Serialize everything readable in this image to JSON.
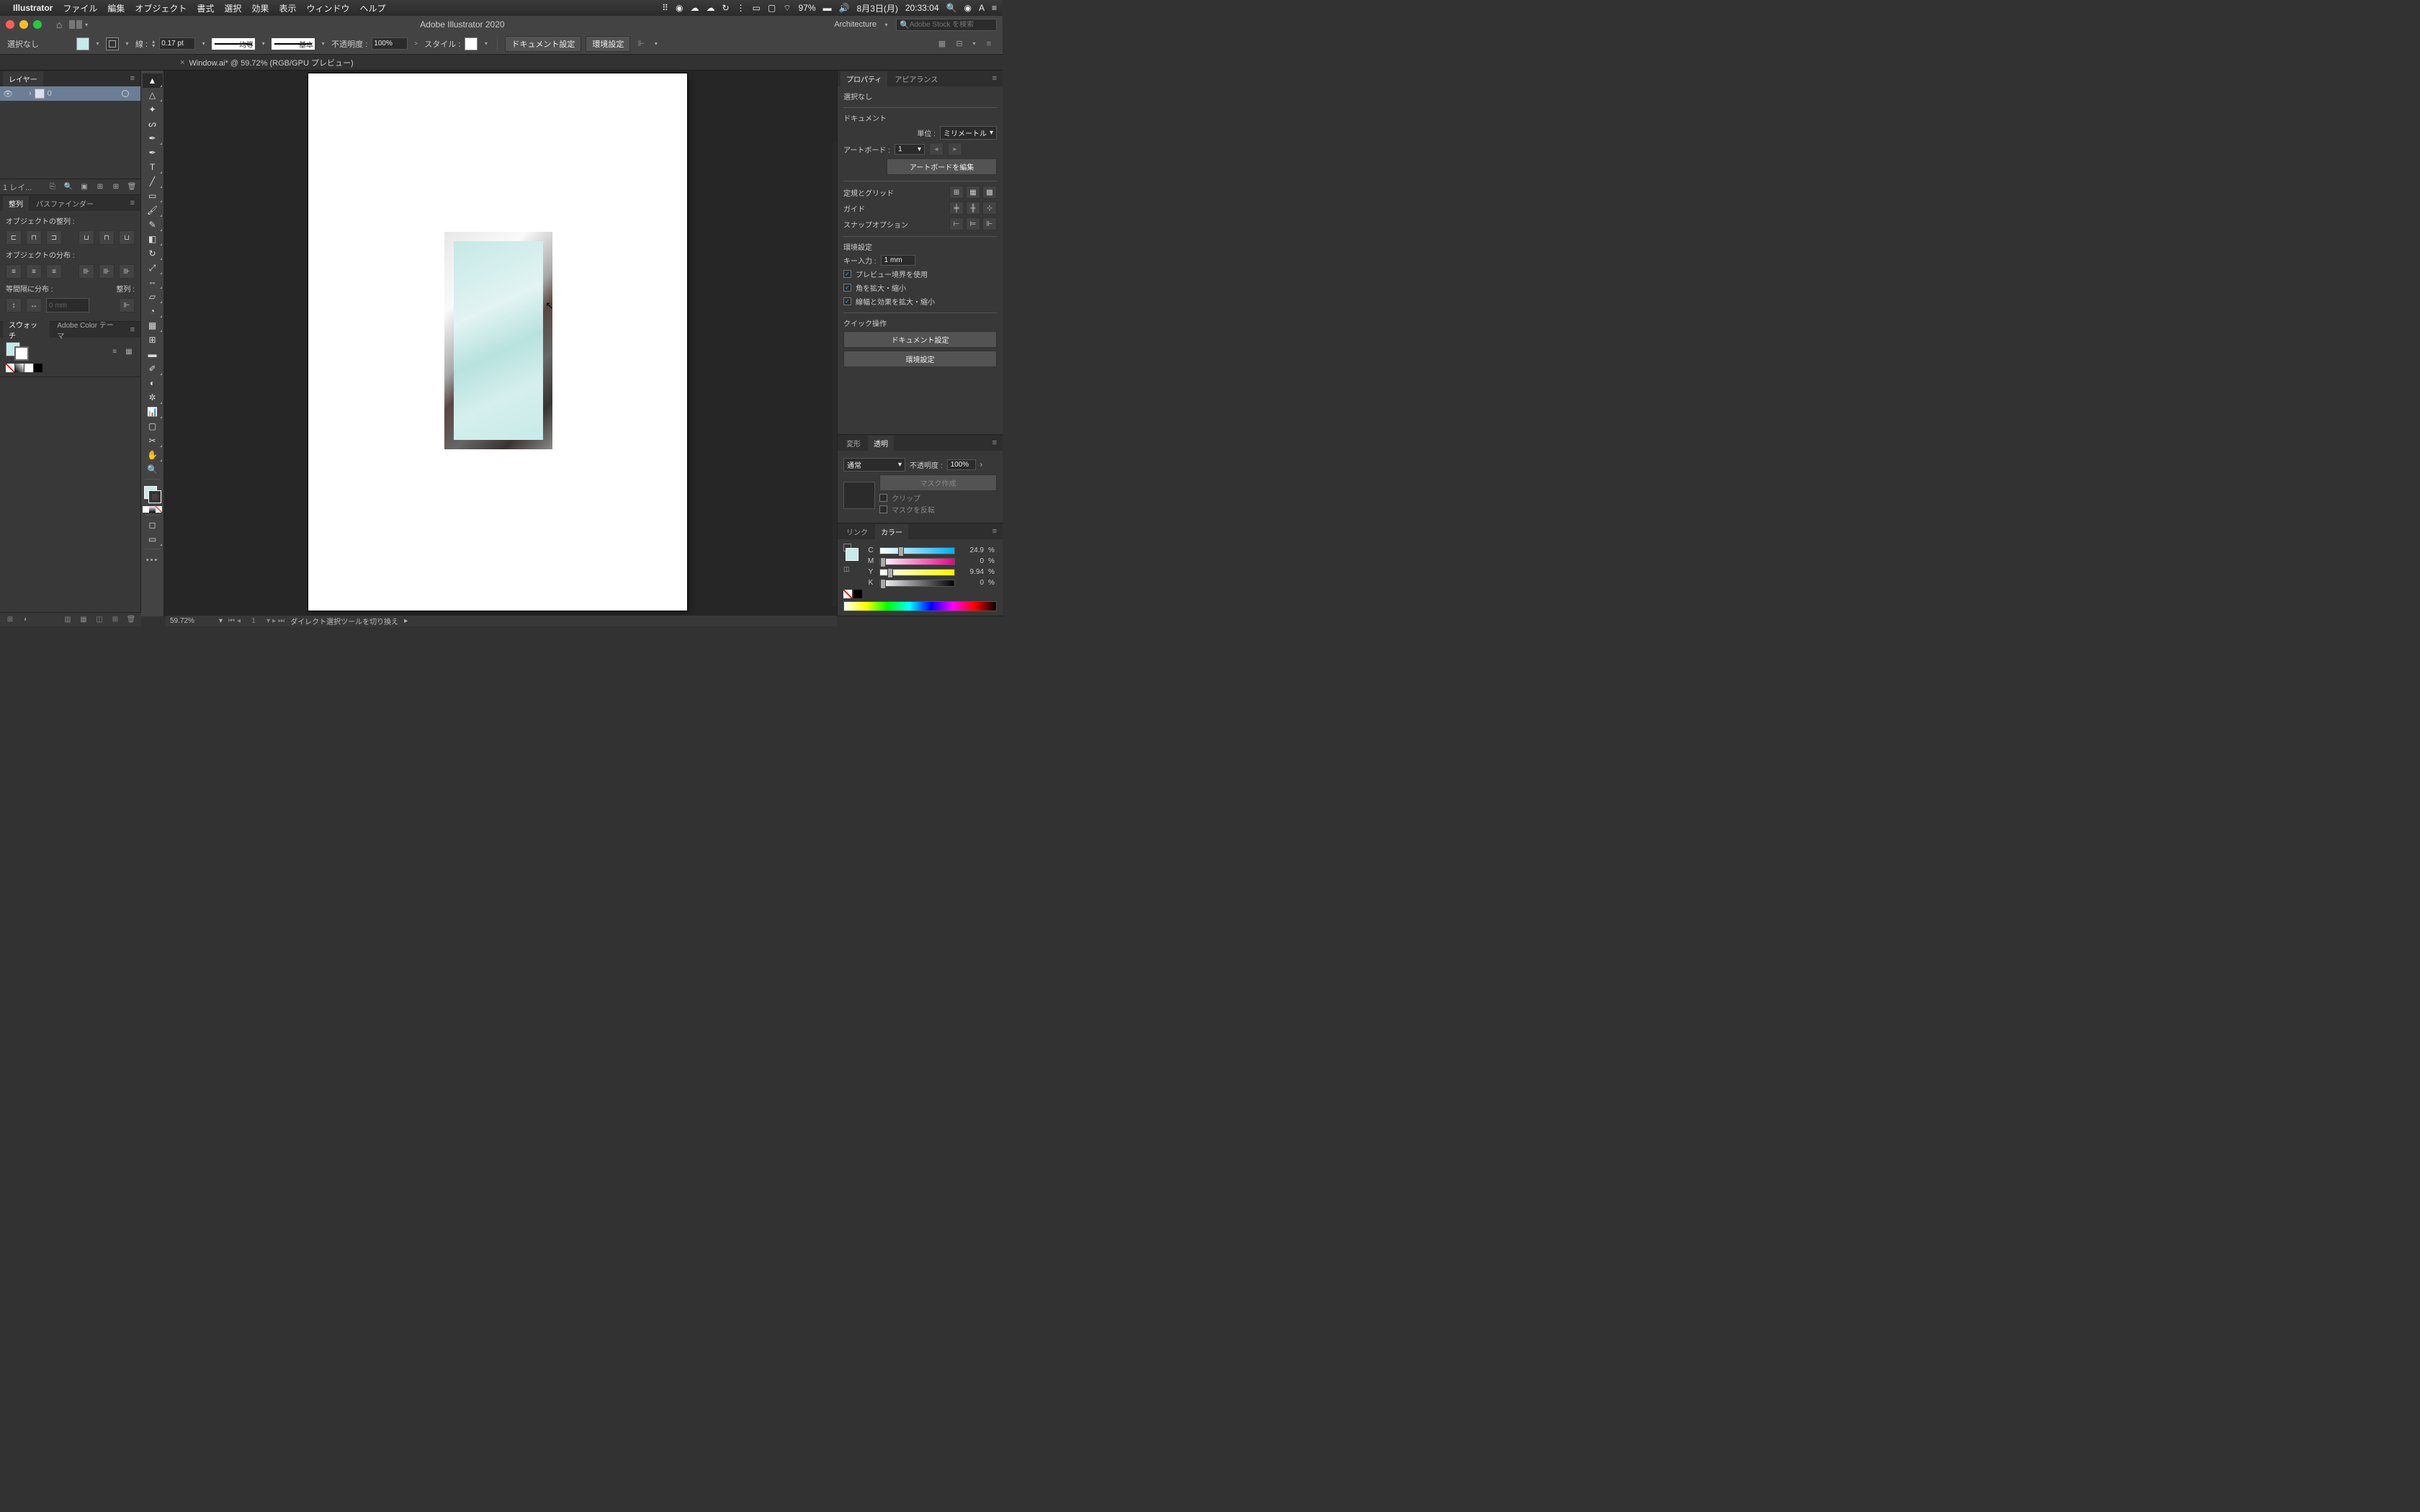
{
  "menubar": {
    "apple": "",
    "app": "Illustrator",
    "items": [
      "ファイル",
      "編集",
      "オブジェクト",
      "書式",
      "選択",
      "効果",
      "表示",
      "ウィンドウ",
      "ヘルプ"
    ],
    "battery": "97%",
    "date": "8月3日(月)",
    "time": "20:33:04"
  },
  "titlebar": {
    "title": "Adobe Illustrator 2020",
    "workspace": "Architecture",
    "stock_placeholder": "Adobe Stock を検索"
  },
  "controlbar": {
    "selection": "選択なし",
    "stroke_label": "線 :",
    "stroke_val": "0.17 pt",
    "stroke_profile": "均等",
    "stroke_brush": "基本",
    "opacity_label": "不透明度 :",
    "opacity_val": "100%",
    "style_label": "スタイル :",
    "doc_setup": "ドキュメント設定",
    "prefs": "環境設定"
  },
  "tab": {
    "name": "Window.ai* @ 59.72% (RGB/GPU プレビュー)"
  },
  "layers": {
    "tab": "レイヤー",
    "layer_name": "0",
    "footer": "1 レイ..."
  },
  "align": {
    "tab1": "整列",
    "tab2": "パスファインダー",
    "sec1": "オブジェクトの整列 :",
    "sec2": "オブジェクトの分布 :",
    "sec3": "等間隔に分布 :",
    "sec3r": "整列 :",
    "val0": "0 mm"
  },
  "swatches": {
    "tab1": "スウォッチ",
    "tab2": "Adobe Color テーマ"
  },
  "properties": {
    "tab1": "プロパティ",
    "tab2": "アピアランス",
    "no_sel": "選択なし",
    "doc": "ドキュメント",
    "units_label": "単位 :",
    "units_val": "ミリメートル",
    "ab_label": "アートボード :",
    "ab_val": "1",
    "ab_edit": "アートボードを編集",
    "ruler_grid": "定規とグリッド",
    "guide": "ガイド",
    "snap": "スナップオプション",
    "prefs": "環境設定",
    "key_label": "キー入力 :",
    "key_val": "1 mm",
    "chk1": "プレビュー境界を使用",
    "chk2": "角を拡大・縮小",
    "chk3": "線幅と効果を拡大・縮小",
    "quick": "クイック操作",
    "btn1": "ドキュメント設定",
    "btn2": "環境設定"
  },
  "transparency": {
    "tab1": "変形",
    "tab2": "透明",
    "mode": "通常",
    "op_label": "不透明度 :",
    "op_val": "100%",
    "mask": "マスク作成",
    "clip": "クリップ",
    "invert": "マスクを反転"
  },
  "color": {
    "tab1": "リンク",
    "tab2": "カラー",
    "c": "C",
    "m": "M",
    "y": "Y",
    "k": "K",
    "cv": "24.9",
    "mv": "0",
    "yv": "9.94",
    "kv": "0",
    "pct": "%"
  },
  "status": {
    "zoom": "59.72%",
    "ab": "1",
    "hint": "ダイレクト選択ツールを切り換え"
  }
}
